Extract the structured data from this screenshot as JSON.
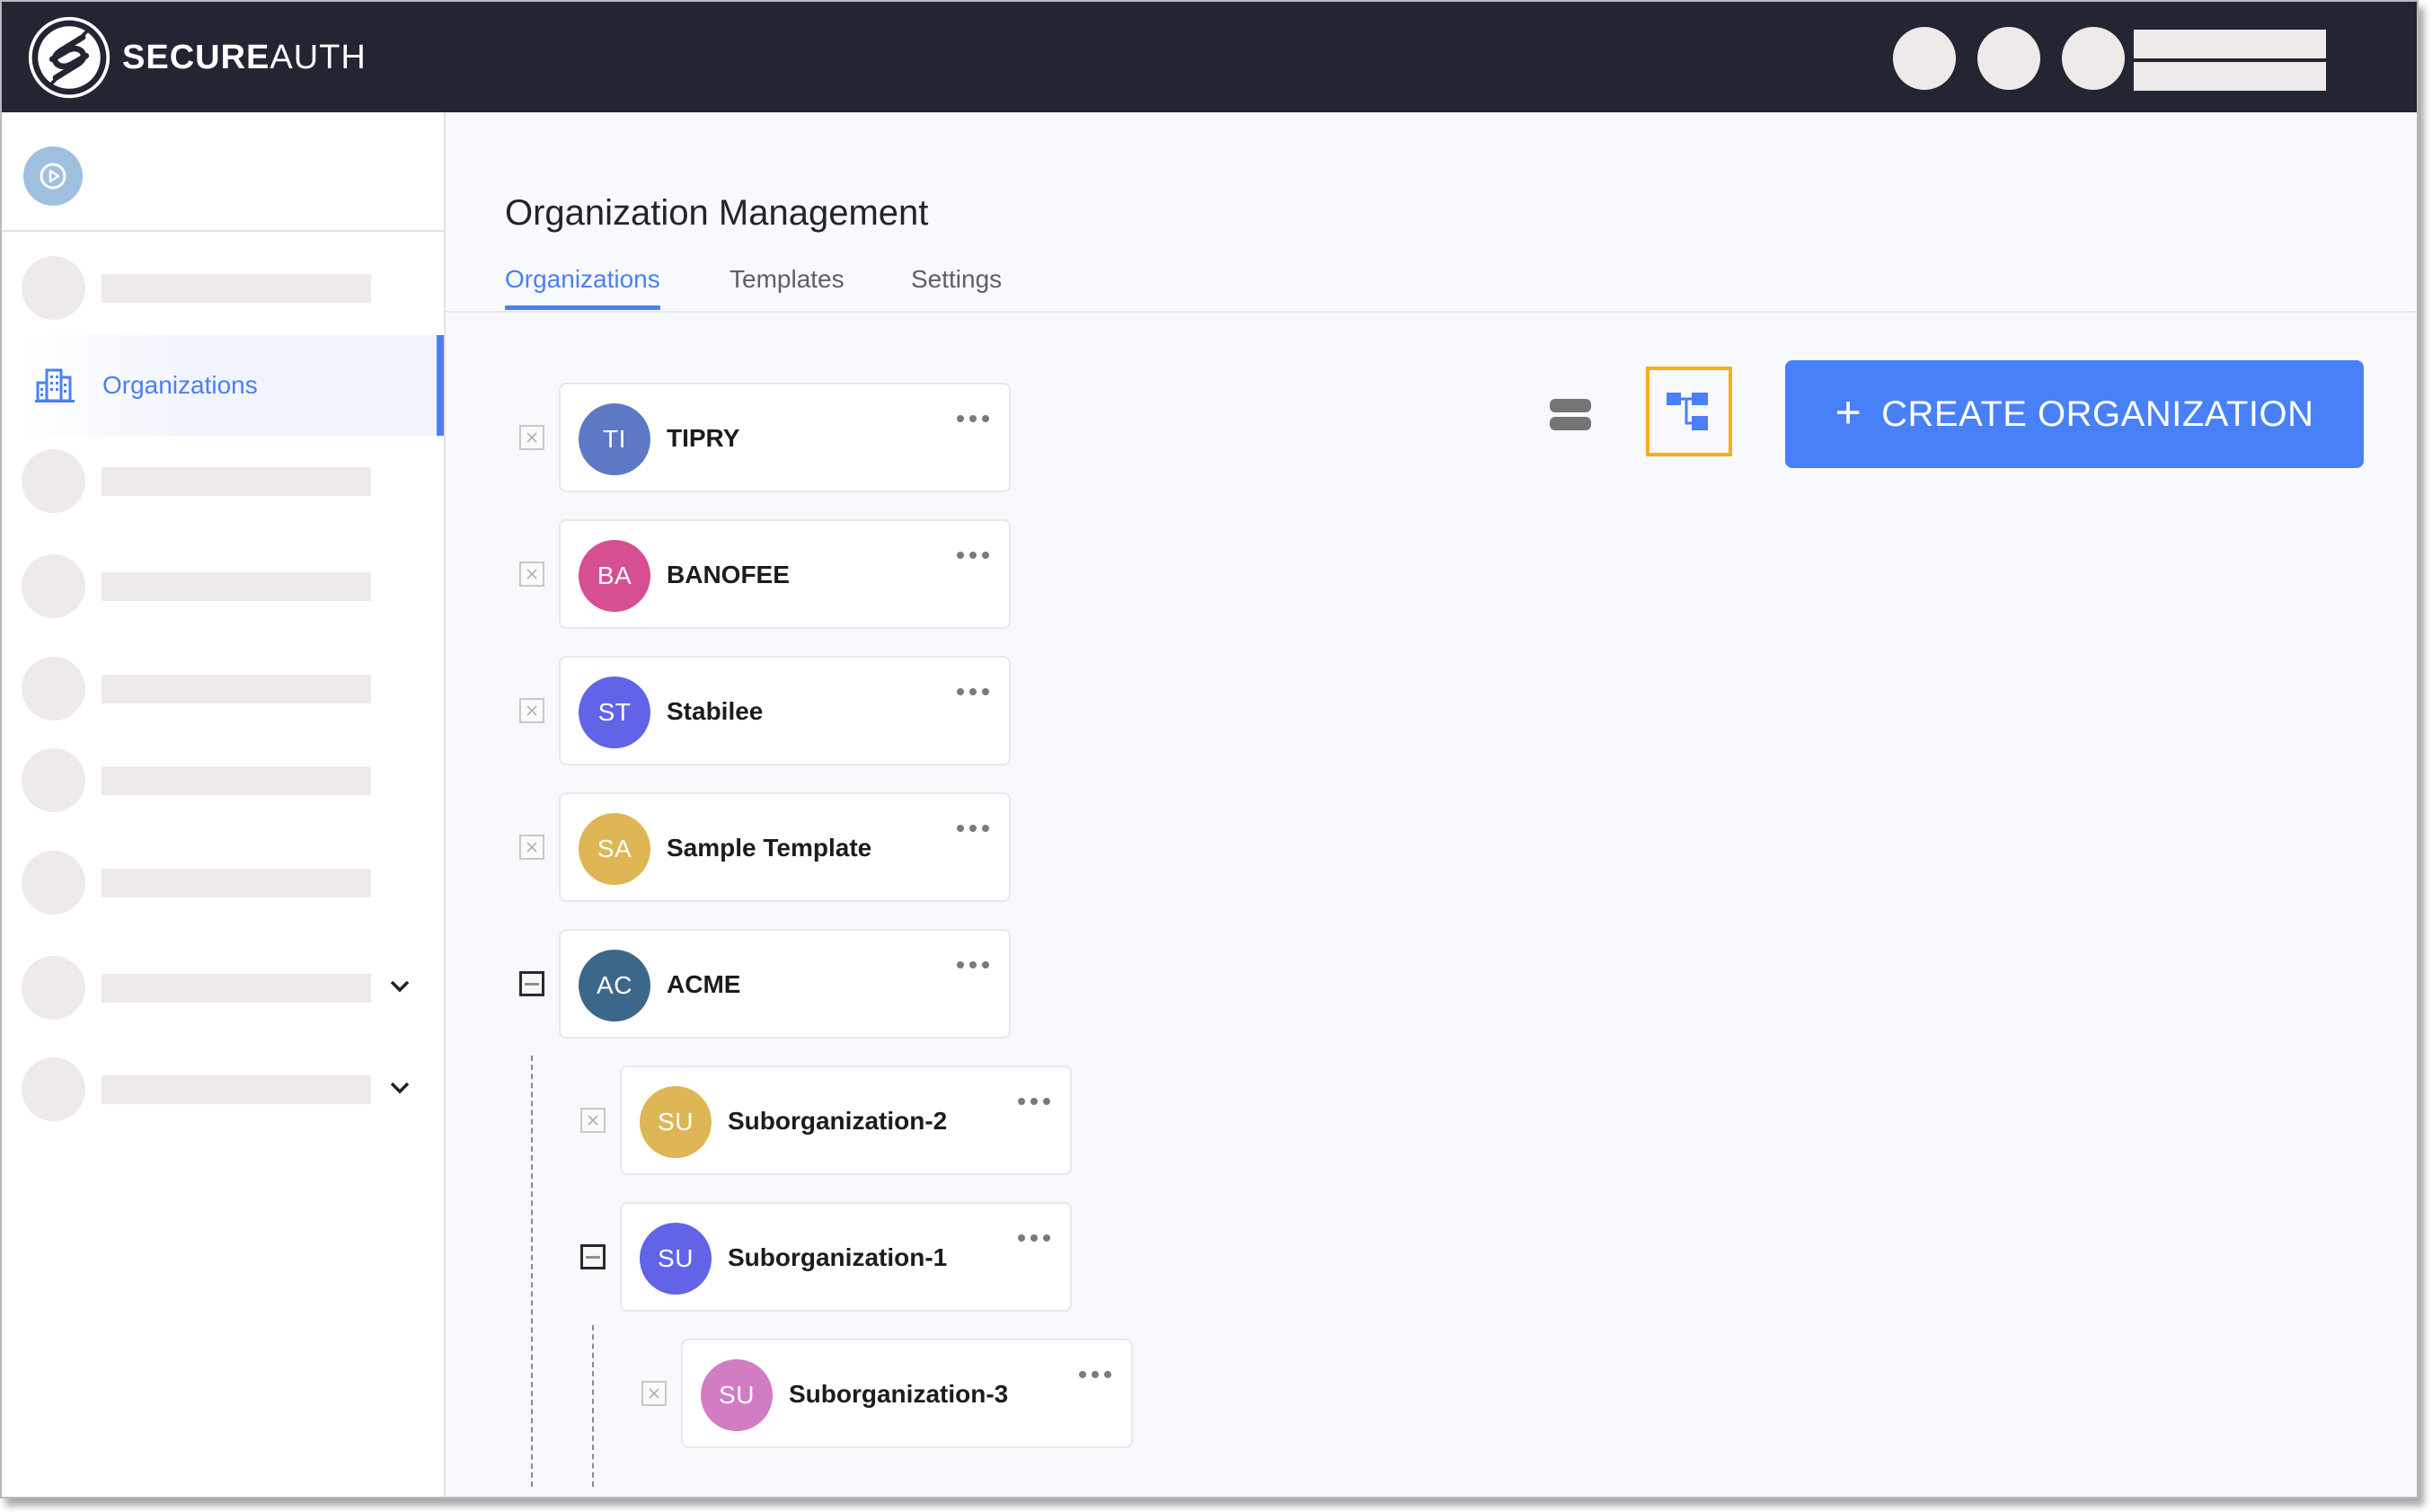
{
  "brand": {
    "bold": "SECURE",
    "light": "AUTH"
  },
  "sidebar": {
    "active_item": {
      "label": "Organizations",
      "icon": "buildings-icon",
      "accent": "#4a7ff5"
    }
  },
  "page": {
    "title": "Organization Management",
    "tabs": [
      {
        "label": "Organizations",
        "active": true
      },
      {
        "label": "Templates",
        "active": false
      },
      {
        "label": "Settings",
        "active": false
      }
    ]
  },
  "toolbar": {
    "list_view_icon": "list-view-icon",
    "tree_view_icon": "tree-view-icon",
    "tree_view_selected": true,
    "create_label": "CREATE ORGANIZATION",
    "create_icon": "+",
    "create_color": "#4880f8"
  },
  "tree": [
    {
      "initials": "TI",
      "name": "TIPRY",
      "color": "#5e79c3",
      "level": 0,
      "state": "leaf"
    },
    {
      "initials": "BA",
      "name": "BANOFEE",
      "color": "#d64f90",
      "level": 0,
      "state": "leaf"
    },
    {
      "initials": "ST",
      "name": "Stabilee",
      "color": "#6263e6",
      "level": 0,
      "state": "leaf"
    },
    {
      "initials": "SA",
      "name": "Sample Template",
      "color": "#dfb656",
      "level": 0,
      "state": "leaf"
    },
    {
      "initials": "AC",
      "name": "ACME",
      "color": "#3d6789",
      "level": 0,
      "state": "expanded"
    },
    {
      "initials": "SU",
      "name": "Suborganization-2",
      "color": "#dfb656",
      "level": 1,
      "state": "leaf"
    },
    {
      "initials": "SU",
      "name": "Suborganization-1",
      "color": "#6263e6",
      "level": 1,
      "state": "expanded"
    },
    {
      "initials": "SU",
      "name": "Suborganization-3",
      "color": "#d17cc3",
      "level": 2,
      "state": "leaf"
    }
  ]
}
